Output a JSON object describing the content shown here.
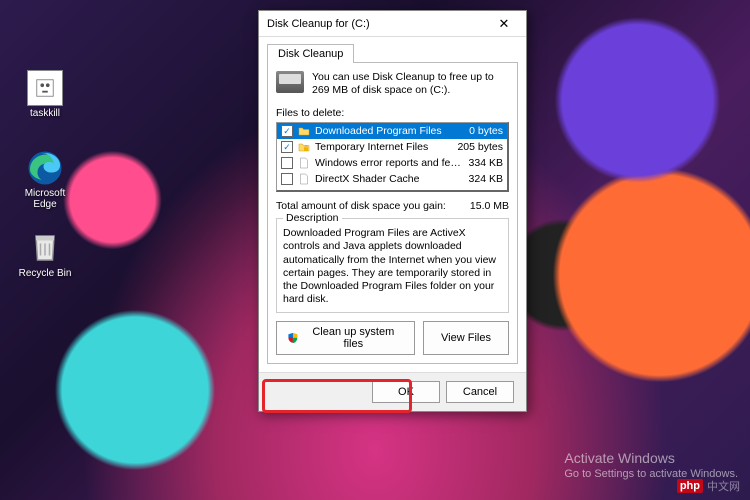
{
  "desktop_icons": {
    "taskkill": "taskkill",
    "edge": "Microsoft Edge",
    "recycle": "Recycle Bin"
  },
  "dialog": {
    "title": "Disk Cleanup for  (C:)",
    "tab_label": "Disk Cleanup",
    "intro": "You can use Disk Cleanup to free up to 269 MB of disk space on  (C:).",
    "files_to_delete_label": "Files to delete:",
    "items": [
      {
        "name": "Downloaded Program Files",
        "size": "0 bytes",
        "checked": true,
        "selected": true
      },
      {
        "name": "Temporary Internet Files",
        "size": "205 bytes",
        "checked": true,
        "selected": false
      },
      {
        "name": "Windows error reports and feedback di...",
        "size": "334 KB",
        "checked": false,
        "selected": false
      },
      {
        "name": "DirectX Shader Cache",
        "size": "324 KB",
        "checked": false,
        "selected": false
      }
    ],
    "total_label": "Total amount of disk space you gain:",
    "total_value": "15.0 MB",
    "description_label": "Description",
    "description_text": "Downloaded Program Files are ActiveX controls and Java applets downloaded automatically from the Internet when you view certain pages. They are temporarily stored in the Downloaded Program Files folder on your hard disk.",
    "clean_system_btn": "Clean up system files",
    "view_files_btn": "View Files",
    "ok_btn": "OK",
    "cancel_btn": "Cancel"
  },
  "watermark": {
    "title": "Activate Windows",
    "sub": "Go to Settings to activate Windows."
  },
  "logo": {
    "p": "php",
    "cn": "中文网"
  }
}
